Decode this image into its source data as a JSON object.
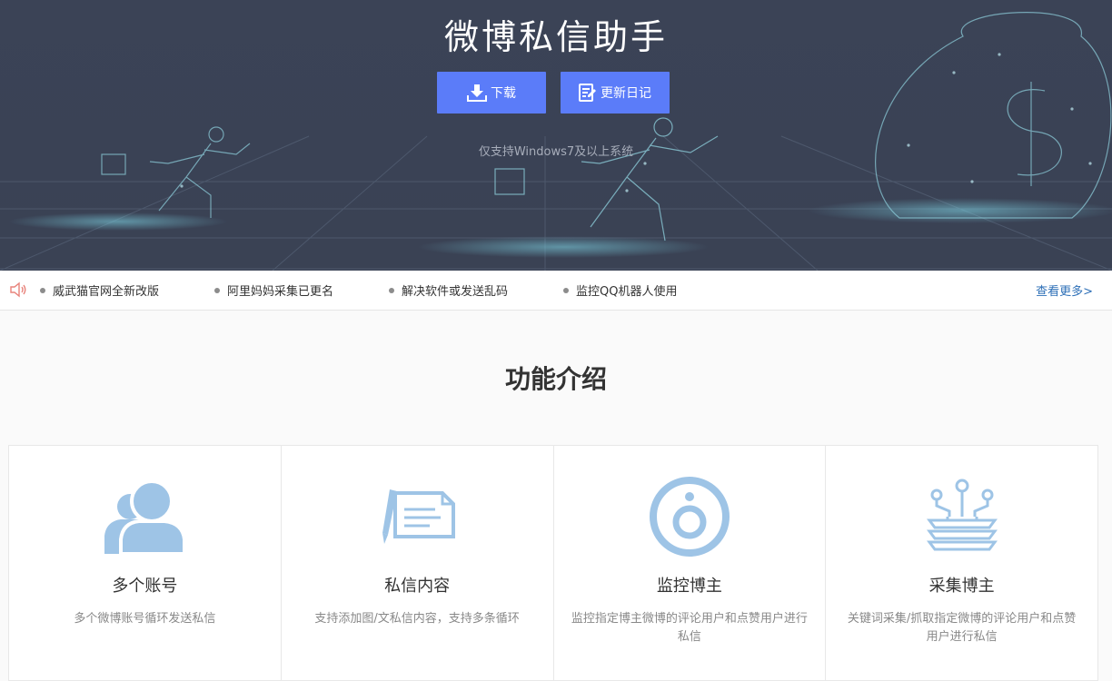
{
  "hero": {
    "title": "微博私信助手",
    "download_label": "下载",
    "changelog_label": "更新日记",
    "note": "仅支持Windows7及以上系统"
  },
  "news": {
    "items": [
      "威武猫官网全新改版",
      "阿里妈妈采集已更名",
      "解决软件或发送乱码",
      "监控QQ机器人使用"
    ],
    "more_label": "查看更多>"
  },
  "features": {
    "title": "功能介绍",
    "cards": [
      {
        "icon": "users-icon",
        "title": "多个账号",
        "desc": "多个微博账号循环发送私信"
      },
      {
        "icon": "message-edit-icon",
        "title": "私信内容",
        "desc": "支持添加图/文私信内容，支持多条循环"
      },
      {
        "icon": "monitor-target-icon",
        "title": "监控博主",
        "desc": "监控指定博主微博的评论用户和点赞用户进行私信"
      },
      {
        "icon": "collect-layers-icon",
        "title": "采集博主",
        "desc": "关键词采集/抓取指定微博的评论用户和点赞用户进行私信"
      }
    ]
  },
  "colors": {
    "hero_bg": "#3b4356",
    "button": "#5b7cf9",
    "icon": "#9ec4e6",
    "link": "#2d6fb7"
  }
}
